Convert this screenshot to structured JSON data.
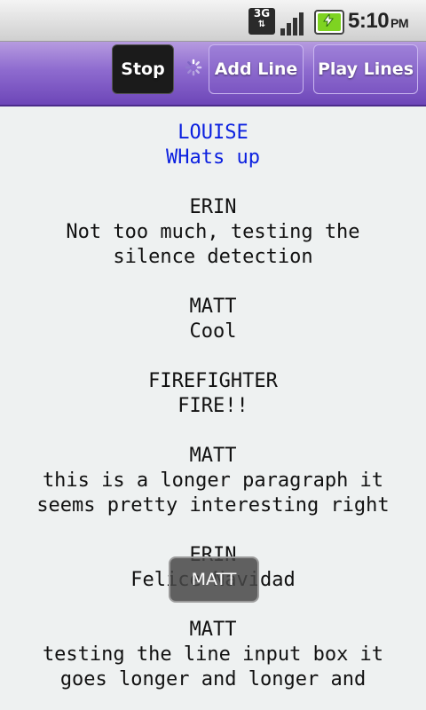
{
  "status_bar": {
    "network": "3G",
    "time": "5:10",
    "ampm": "PM"
  },
  "toolbar": {
    "stop_label": "Stop",
    "add_line_label": "Add Line",
    "play_lines_label": "Play Lines"
  },
  "lines": [
    {
      "speaker": "LOUISE",
      "dialogue": "WHats up"
    },
    {
      "speaker": "ERIN",
      "dialogue": "Not too much, testing the silence detection"
    },
    {
      "speaker": "MATT",
      "dialogue": "Cool"
    },
    {
      "speaker": "FIREFIGHTER",
      "dialogue": "FIRE!!"
    },
    {
      "speaker": "MATT",
      "dialogue": "this is a longer paragraph it seems pretty interesting right"
    },
    {
      "speaker": "ERIN",
      "dialogue": "Felice Navidad"
    },
    {
      "speaker": "MATT",
      "dialogue": "testing the line input box it goes longer and longer and"
    }
  ],
  "toast": {
    "text": "MATT"
  },
  "colors": {
    "toolbar_purple": "#8e6bcf",
    "active_line": "#0a1fe0",
    "background": "#eef1f1"
  },
  "icons": [
    "3g-network-icon",
    "signal-strength-icon",
    "battery-charging-icon",
    "loading-spinner-icon"
  ]
}
